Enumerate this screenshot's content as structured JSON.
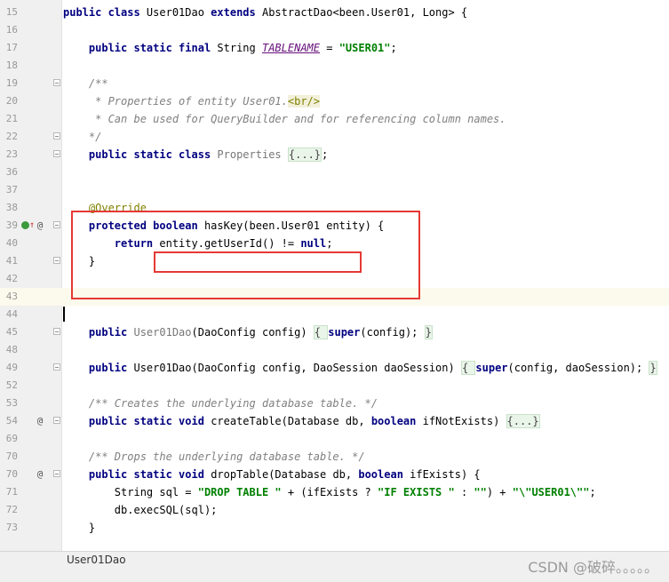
{
  "editor": {
    "file_tab": "User01Dao",
    "watermark": "CSDN @破碎。。。。。",
    "lines": [
      {
        "n": "15",
        "segs": [
          {
            "t": "public class ",
            "c": "kw"
          },
          {
            "t": "User01Dao "
          },
          {
            "t": "extends ",
            "c": "kw"
          },
          {
            "t": "AbstractDao<been.User01, Long> {"
          }
        ]
      },
      {
        "n": "16",
        "segs": []
      },
      {
        "n": "17",
        "segs": [
          {
            "t": "    "
          },
          {
            "t": "public static final ",
            "c": "kw"
          },
          {
            "t": "String "
          },
          {
            "t": "TABLENAME",
            "c": "constant uline"
          },
          {
            "t": " = "
          },
          {
            "t": "\"USER01\"",
            "c": "str"
          },
          {
            "t": ";"
          }
        ]
      },
      {
        "n": "18",
        "segs": []
      },
      {
        "n": "19",
        "fold": true,
        "segs": [
          {
            "t": "    /**",
            "c": "comment"
          }
        ]
      },
      {
        "n": "20",
        "segs": [
          {
            "t": "     * Properties of entity User01.",
            "c": "comment"
          },
          {
            "t": "<br/>",
            "c": "htmltag"
          }
        ]
      },
      {
        "n": "21",
        "segs": [
          {
            "t": "     * Can be used for QueryBuilder and for referencing column names.",
            "c": "comment"
          }
        ]
      },
      {
        "n": "22",
        "fold": true,
        "segs": [
          {
            "t": "    */",
            "c": "comment"
          }
        ]
      },
      {
        "n": "23",
        "fold": true,
        "segs": [
          {
            "t": "    "
          },
          {
            "t": "public static class ",
            "c": "kw"
          },
          {
            "t": "Properties ",
            "c": "dimmed"
          },
          {
            "t": "{...}",
            "c": "folded"
          },
          {
            "t": ";"
          }
        ]
      },
      {
        "n": "36",
        "segs": []
      },
      {
        "n": "37",
        "segs": []
      },
      {
        "n": "38",
        "segs": [
          {
            "t": "    "
          },
          {
            "t": "@Override",
            "c": "anno"
          }
        ]
      },
      {
        "n": "39",
        "icons": [
          "override",
          "up-arrow",
          "at"
        ],
        "fold": true,
        "segs": [
          {
            "t": "    "
          },
          {
            "t": "protected boolean ",
            "c": "kw"
          },
          {
            "t": "hasKey(been.User01 entity) {"
          }
        ]
      },
      {
        "n": "40",
        "segs": [
          {
            "t": "        "
          },
          {
            "t": "return ",
            "c": "kw"
          },
          {
            "t": "entity.getUserId() != "
          },
          {
            "t": "null",
            "c": "kw"
          },
          {
            "t": ";"
          }
        ]
      },
      {
        "n": "41",
        "fold": true,
        "segs": [
          {
            "t": "    }"
          }
        ]
      },
      {
        "n": "42",
        "segs": []
      },
      {
        "n": "43",
        "current": true,
        "segs": []
      },
      {
        "n": "44",
        "segs": []
      },
      {
        "n": "45",
        "fold": true,
        "segs": [
          {
            "t": "    "
          },
          {
            "t": "public ",
            "c": "kw"
          },
          {
            "t": "User01Dao",
            "c": "dimmed"
          },
          {
            "t": "(DaoConfig config) "
          },
          {
            "t": "{ ",
            "c": "folded"
          },
          {
            "t": "super",
            "c": "kw"
          },
          {
            "t": "(config); "
          },
          {
            "t": "}",
            "c": "folded"
          }
        ]
      },
      {
        "n": "48",
        "segs": []
      },
      {
        "n": "49",
        "fold": true,
        "segs": [
          {
            "t": "    "
          },
          {
            "t": "public ",
            "c": "kw"
          },
          {
            "t": "User01Dao(DaoConfig config, DaoSession daoSession) "
          },
          {
            "t": "{ ",
            "c": "folded"
          },
          {
            "t": "super",
            "c": "kw"
          },
          {
            "t": "(config, daoSession); "
          },
          {
            "t": "}",
            "c": "folded"
          }
        ]
      },
      {
        "n": "52",
        "segs": []
      },
      {
        "n": "53",
        "segs": [
          {
            "t": "    /** Creates the underlying database table. */",
            "c": "comment"
          }
        ]
      },
      {
        "n": "54",
        "icons": [
          "at"
        ],
        "fold": true,
        "segs": [
          {
            "t": "    "
          },
          {
            "t": "public static void ",
            "c": "kw"
          },
          {
            "t": "createTable(Database db, "
          },
          {
            "t": "boolean ",
            "c": "kw"
          },
          {
            "t": "ifNotExists) "
          },
          {
            "t": "{...}",
            "c": "folded"
          }
        ]
      },
      {
        "n": "69",
        "segs": []
      },
      {
        "n": "70",
        "segs": [
          {
            "t": "    /** Drops the underlying database table. */",
            "c": "comment"
          }
        ]
      },
      {
        "n": "70",
        "icons": [
          "at"
        ],
        "fold": true,
        "segs": [
          {
            "t": "    "
          },
          {
            "t": "public static void ",
            "c": "kw"
          },
          {
            "t": "dropTable(Database db, "
          },
          {
            "t": "boolean ",
            "c": "kw"
          },
          {
            "t": "ifExists) {"
          }
        ]
      },
      {
        "n": "71",
        "segs": [
          {
            "t": "        String sql = "
          },
          {
            "t": "\"DROP TABLE \"",
            "c": "str"
          },
          {
            "t": " + (ifExists ? "
          },
          {
            "t": "\"IF EXISTS \"",
            "c": "str"
          },
          {
            "t": " : "
          },
          {
            "t": "\"\"",
            "c": "str"
          },
          {
            "t": ") + "
          },
          {
            "t": "\"\\\"USER01\\\"\"",
            "c": "str"
          },
          {
            "t": ";"
          }
        ]
      },
      {
        "n": "72",
        "segs": [
          {
            "t": "        db.execSQL(sql);"
          }
        ]
      },
      {
        "n": "73",
        "segs": [
          {
            "t": "    }"
          }
        ]
      }
    ]
  }
}
